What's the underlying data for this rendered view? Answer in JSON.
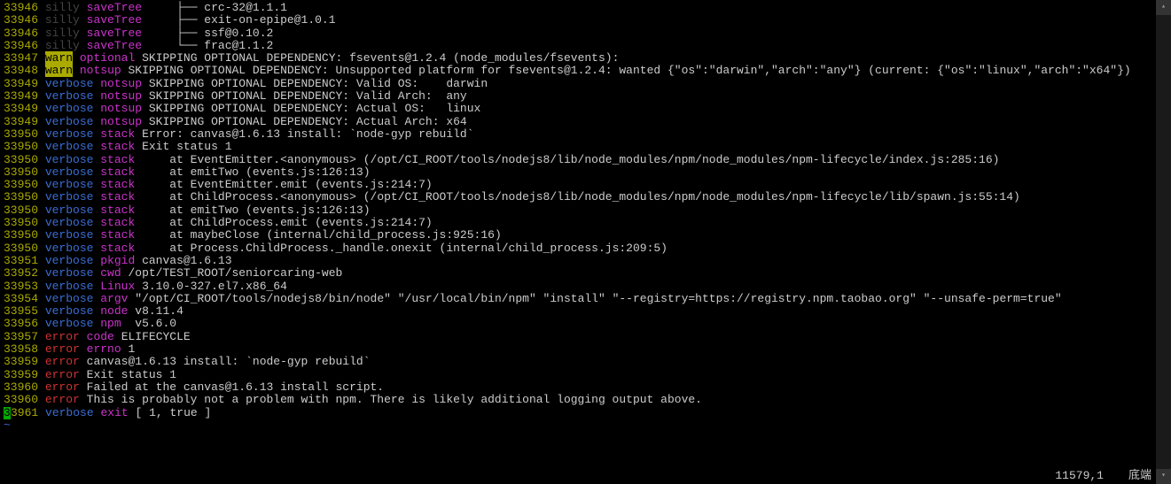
{
  "lines": [
    {
      "no": "33946",
      "level": "silly",
      "tag": "saveTree",
      "text": "    ├── crc-32@1.1.1"
    },
    {
      "no": "33946",
      "level": "silly",
      "tag": "saveTree",
      "text": "    ├── exit-on-epipe@1.0.1"
    },
    {
      "no": "33946",
      "level": "silly",
      "tag": "saveTree",
      "text": "    ├── ssf@0.10.2"
    },
    {
      "no": "33946",
      "level": "silly",
      "tag": "saveTree",
      "text": "    └── frac@1.1.2"
    },
    {
      "no": "33947",
      "level": "warn",
      "tag": "optional",
      "text": "SKIPPING OPTIONAL DEPENDENCY: fsevents@1.2.4 (node_modules/fsevents):"
    },
    {
      "no": "33948",
      "level": "warn",
      "tag": "notsup",
      "text": "SKIPPING OPTIONAL DEPENDENCY: Unsupported platform for fsevents@1.2.4: wanted {\"os\":\"darwin\",\"arch\":\"any\"} (current: {\"os\":\"linux\",\"arch\":\"x64\"})"
    },
    {
      "no": "33949",
      "level": "verbose",
      "tag": "notsup",
      "text": "SKIPPING OPTIONAL DEPENDENCY: Valid OS:    darwin"
    },
    {
      "no": "33949",
      "level": "verbose",
      "tag": "notsup",
      "text": "SKIPPING OPTIONAL DEPENDENCY: Valid Arch:  any"
    },
    {
      "no": "33949",
      "level": "verbose",
      "tag": "notsup",
      "text": "SKIPPING OPTIONAL DEPENDENCY: Actual OS:   linux"
    },
    {
      "no": "33949",
      "level": "verbose",
      "tag": "notsup",
      "text": "SKIPPING OPTIONAL DEPENDENCY: Actual Arch: x64"
    },
    {
      "no": "33950",
      "level": "verbose",
      "tag": "stack",
      "text": "Error: canvas@1.6.13 install: `node-gyp rebuild`"
    },
    {
      "no": "33950",
      "level": "verbose",
      "tag": "stack",
      "text": "Exit status 1"
    },
    {
      "no": "33950",
      "level": "verbose",
      "tag": "stack",
      "text": "    at EventEmitter.<anonymous> (/opt/CI_ROOT/tools/nodejs8/lib/node_modules/npm/node_modules/npm-lifecycle/index.js:285:16)"
    },
    {
      "no": "33950",
      "level": "verbose",
      "tag": "stack",
      "text": "    at emitTwo (events.js:126:13)"
    },
    {
      "no": "33950",
      "level": "verbose",
      "tag": "stack",
      "text": "    at EventEmitter.emit (events.js:214:7)"
    },
    {
      "no": "33950",
      "level": "verbose",
      "tag": "stack",
      "text": "    at ChildProcess.<anonymous> (/opt/CI_ROOT/tools/nodejs8/lib/node_modules/npm/node_modules/npm-lifecycle/lib/spawn.js:55:14)"
    },
    {
      "no": "33950",
      "level": "verbose",
      "tag": "stack",
      "text": "    at emitTwo (events.js:126:13)"
    },
    {
      "no": "33950",
      "level": "verbose",
      "tag": "stack",
      "text": "    at ChildProcess.emit (events.js:214:7)"
    },
    {
      "no": "33950",
      "level": "verbose",
      "tag": "stack",
      "text": "    at maybeClose (internal/child_process.js:925:16)"
    },
    {
      "no": "33950",
      "level": "verbose",
      "tag": "stack",
      "text": "    at Process.ChildProcess._handle.onexit (internal/child_process.js:209:5)"
    },
    {
      "no": "33951",
      "level": "verbose",
      "tag": "pkgid",
      "text": "canvas@1.6.13"
    },
    {
      "no": "33952",
      "level": "verbose",
      "tag": "cwd",
      "text": "/opt/TEST_ROOT/seniorcaring-web"
    },
    {
      "no": "33953",
      "level": "verbose",
      "tag": "Linux",
      "text": "3.10.0-327.el7.x86_64"
    },
    {
      "no": "33954",
      "level": "verbose",
      "tag": "argv",
      "text": "\"/opt/CI_ROOT/tools/nodejs8/bin/node\" \"/usr/local/bin/npm\" \"install\" \"--registry=https://registry.npm.taobao.org\" \"--unsafe-perm=true\""
    },
    {
      "no": "33955",
      "level": "verbose",
      "tag": "node",
      "text": "v8.11.4"
    },
    {
      "no": "33956",
      "level": "verbose",
      "tag": "npm",
      "text": " v5.6.0"
    },
    {
      "no": "33957",
      "level": "error",
      "tag": "code",
      "text": "ELIFECYCLE"
    },
    {
      "no": "33958",
      "level": "error",
      "tag": "errno",
      "text": "1"
    },
    {
      "no": "33959",
      "level": "error",
      "tag": "",
      "text": "canvas@1.6.13 install: `node-gyp rebuild`"
    },
    {
      "no": "33959",
      "level": "error",
      "tag": "",
      "text": "Exit status 1"
    },
    {
      "no": "33960",
      "level": "error",
      "tag": "",
      "text": "Failed at the canvas@1.6.13 install script."
    },
    {
      "no": "33960",
      "level": "error",
      "tag": "",
      "text": "This is probably not a problem with npm. There is likely additional logging output above."
    }
  ],
  "last_line": {
    "no": "3961",
    "level": "verbose",
    "tag": "exit",
    "text": "[ 1, true ]",
    "cursor_prefix": "3"
  },
  "tilde": "~",
  "status": {
    "pos": "11579,1",
    "loc": "底端"
  }
}
